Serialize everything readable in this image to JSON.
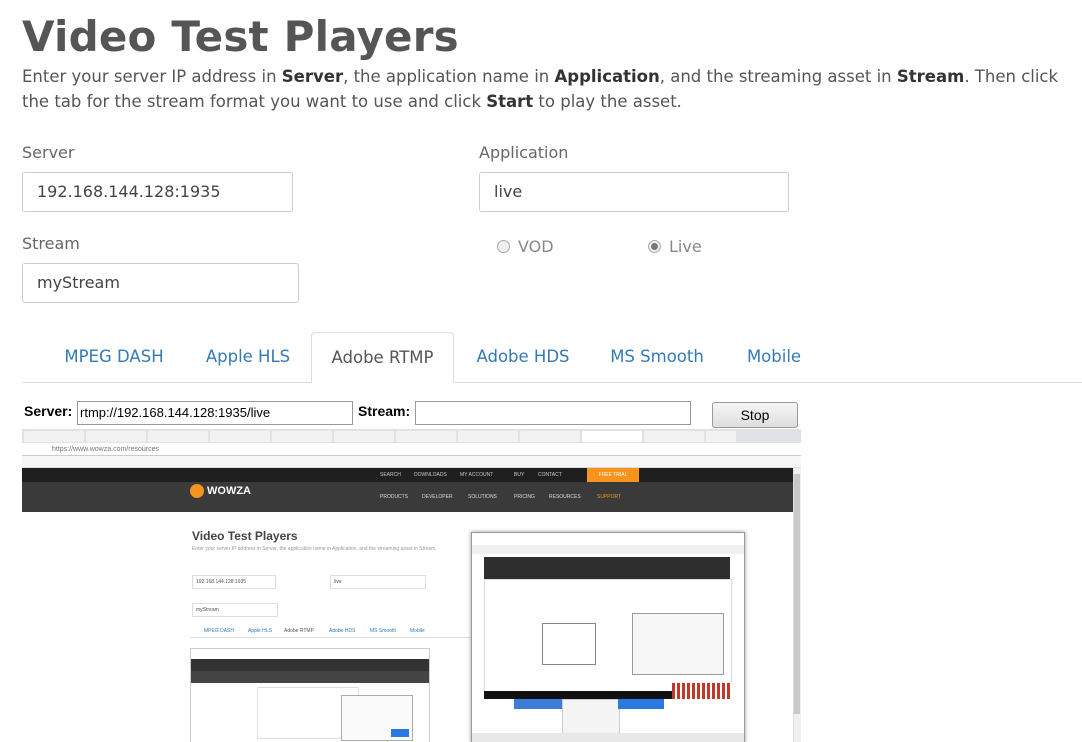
{
  "page": {
    "title": "Video Test Players",
    "intro": {
      "t1": "Enter your server IP address in ",
      "b1": "Server",
      "t2": ", the application name in ",
      "b2": "Application",
      "t3": ", and the streaming asset in ",
      "b3": "Stream",
      "t4": ". Then click the tab for the stream format you want to use and click ",
      "b4": "Start",
      "t5": " to play the asset."
    }
  },
  "form": {
    "server_label": "Server",
    "server_value": "192.168.144.128:1935",
    "application_label": "Application",
    "application_value": "live",
    "stream_label": "Stream",
    "stream_value": "myStream",
    "radio_vod": "VOD",
    "radio_live": "Live",
    "selected": "Live"
  },
  "tabs": [
    "MPEG DASH",
    "Apple HLS",
    "Adobe RTMP",
    "Adobe HDS",
    "MS Smooth",
    "Mobile"
  ],
  "active_tab": "Adobe RTMP",
  "player": {
    "server_label": "Server:",
    "server_value": "rtmp://192.168.144.128:1935/live",
    "stream_label": "Stream:",
    "stream_value": "",
    "stop_label": "Stop"
  },
  "video": {
    "address": "https://www.wowza.com/resources",
    "top_links": [
      "SEARCH",
      "DOWNLOADS",
      "MY ACCOUNT",
      "BUY",
      "CONTACT",
      "FREE TRIAL"
    ],
    "nav_links": [
      "PRODUCTS",
      "DEVELOPER",
      "SOLUTIONS",
      "PRICING",
      "RESOURCES",
      "SUPPORT"
    ],
    "logo_text": "WOWZA",
    "logo_sub": "media systems",
    "title": "Video Test Players",
    "tabs": [
      "MPEG DASH",
      "Apple HLS",
      "Adobe RTMP",
      "Adobe HDS",
      "MS Smooth",
      "Mobile"
    ],
    "server_value": "192.168.144.128:1935",
    "app_value": "live",
    "stream_value": "myStream"
  },
  "colors": {
    "link": "#337ab7",
    "brand_orange": "#f7941d",
    "nav_dark": "#3a3a3a"
  }
}
